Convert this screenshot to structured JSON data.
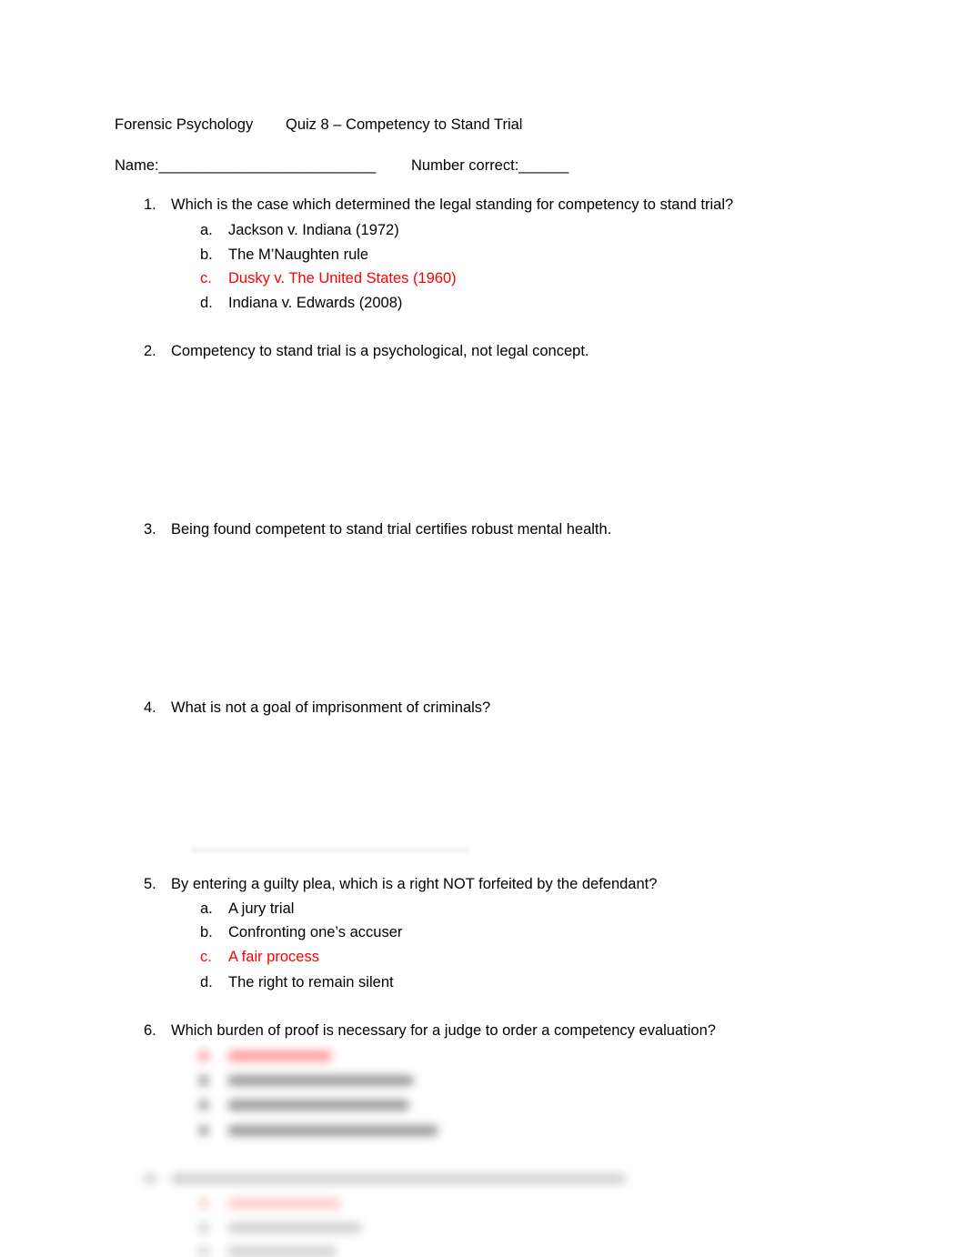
{
  "header": {
    "course": "Forensic Psychology",
    "quiz_title": "Quiz 8 – Competency to Stand Trial",
    "name_label": "Name:__________________________",
    "score_label": "Number correct:______"
  },
  "questions": [
    {
      "number": "1.",
      "text": "Which is the case which determined the legal standing for competency to stand trial?",
      "options": [
        {
          "letter": "a.",
          "text": "Jackson v. Indiana (1972)",
          "correct": false
        },
        {
          "letter": "b.",
          "text": "The M’Naughten rule",
          "correct": false
        },
        {
          "letter": "c.",
          "text": "Dusky v. The United States (1960)",
          "correct": true
        },
        {
          "letter": "d.",
          "text": "Indiana v. Edwards (2008)",
          "correct": false
        }
      ]
    },
    {
      "number": "2.",
      "text": "Competency to stand trial is a psychological, not legal concept."
    },
    {
      "number": "3.",
      "text": "Being found competent to stand trial certifies robust mental health."
    },
    {
      "number": "4.",
      "text": "What is not a goal of imprisonment of criminals?"
    },
    {
      "number": "5.",
      "text": "By entering a guilty plea, which is a right NOT forfeited by the defendant?",
      "options": [
        {
          "letter": "a.",
          "text": "A jury trial",
          "correct": false
        },
        {
          "letter": "b.",
          "text": "Confronting one’s accuser",
          "correct": false
        },
        {
          "letter": "c.",
          "text": "A fair process",
          "correct": true
        },
        {
          "letter": "d.",
          "text": "The right to remain silent",
          "correct": false
        }
      ]
    },
    {
      "number": "6.",
      "text": "Which burden of proof is necessary for a judge to order a competency evaluation?"
    }
  ]
}
